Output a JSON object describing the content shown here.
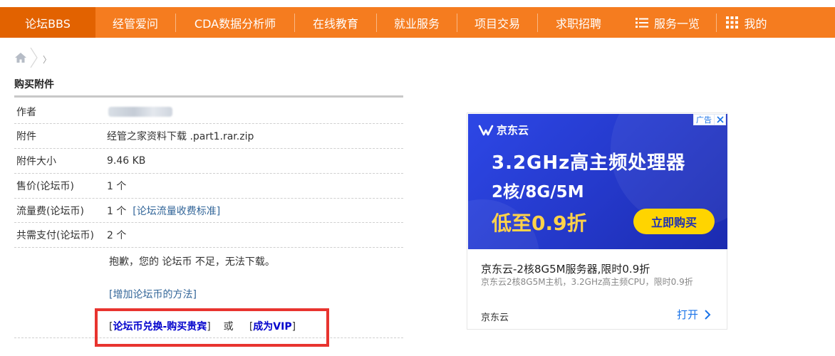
{
  "nav": {
    "items": [
      "论坛BBS",
      "经管爱问",
      "CDA数据分析师",
      "在线教育",
      "就业服务",
      "项目交易",
      "求职招聘"
    ],
    "services": "服务一览",
    "mine": "我的"
  },
  "title": "购买附件",
  "rows": [
    {
      "k": "作者",
      "v": ""
    },
    {
      "k": "附件",
      "v": "经管之家资料下载 .part1.rar.zip"
    },
    {
      "k": "附件大小",
      "v": "9.46 KB"
    },
    {
      "k": "售价(论坛币)",
      "v": "1 个"
    },
    {
      "k": "流量费(论坛币)",
      "v": "1 个"
    },
    {
      "k": "共需支付(论坛币)",
      "v": "2 个"
    }
  ],
  "traffic_link": "[论坛流量收费标准]",
  "sorry": "抱歉，您的 论坛币 不足，无法下载。",
  "method_link": "增加论坛币的方法",
  "buy": {
    "exchange": "论坛币兑换-购买贵宾",
    "or": "或",
    "vip": "成为VIP"
  },
  "ad": {
    "brand": "京东云",
    "tag": "广告",
    "headline1": "3.2GHz高主频处理器",
    "headline2": "2核/8G/5M",
    "headline3": "低至0.9折",
    "cta": "立即购买",
    "title": "京东云-2核8G5M服务器,限时0.9折",
    "desc": "京东云2核8G5M主机，3.2GHz高主频CPU，限时0.9折",
    "source": "京东云",
    "open": "打开"
  }
}
